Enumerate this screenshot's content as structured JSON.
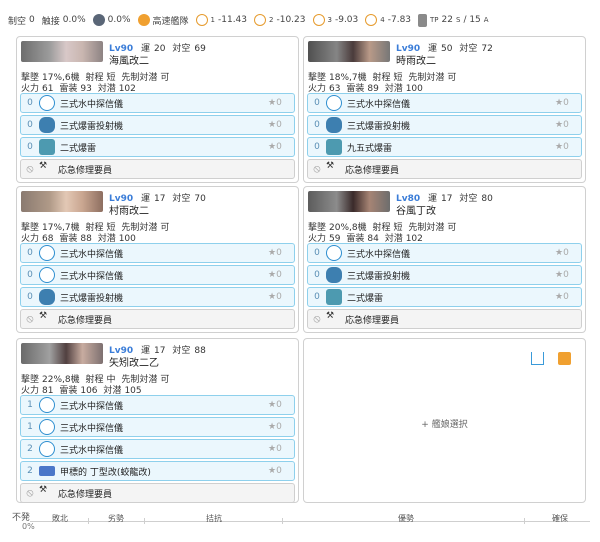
{
  "topbar": {
    "aa_label": "制空",
    "aa_value": "0",
    "touch_label": "触接",
    "touch_value": "0.0%",
    "shield_value": "0.0%",
    "speed_label": "高速艦隊",
    "los": [
      {
        "label": "1",
        "value": "-11.43"
      },
      {
        "label": "2",
        "value": "-10.23"
      },
      {
        "label": "3",
        "value": "-9.03"
      },
      {
        "label": "4",
        "value": "-7.83"
      }
    ],
    "tp_label": "TP",
    "tp_value": "22",
    "tp_s": "S",
    "tp_slash": "/ 15",
    "tp_a": "A",
    "icons": [
      "aircraft-icon",
      "shield-icon",
      "speed-icon",
      "los-icon",
      "transport-icon"
    ],
    "colors": {
      "gold": "#f0a030",
      "dark": "#5a6677"
    }
  },
  "ships": [
    {
      "level": "Lv90",
      "luck_label": "運",
      "luck": "20",
      "aa_label": "対空",
      "aa": "69",
      "name": "海風改二",
      "evasion_label": "撃墜",
      "evasion": "17%,6機",
      "range_label": "射程",
      "range": "短",
      "asw_first_label": "先制対潜",
      "asw_first": "可",
      "fire_label": "火力",
      "fire": "61",
      "torp_label": "雷装",
      "torp": "93",
      "asw_label": "対潜",
      "asw": "102",
      "slots": [
        {
          "count": "0",
          "icon": "sonar-icon",
          "name": "三式水中探信儀",
          "star": "★0"
        },
        {
          "count": "0",
          "icon": "projector-icon",
          "name": "三式爆雷投射機",
          "star": "★0"
        },
        {
          "count": "0",
          "icon": "depth-charge-icon",
          "name": "二式爆雷",
          "star": "★0"
        }
      ],
      "special": {
        "name": "応急修理要員"
      }
    },
    {
      "level": "Lv90",
      "luck_label": "運",
      "luck": "50",
      "aa_label": "対空",
      "aa": "72",
      "name": "時雨改二",
      "evasion_label": "撃墜",
      "evasion": "18%,7機",
      "range_label": "射程",
      "range": "短",
      "asw_first_label": "先制対潜",
      "asw_first": "可",
      "fire_label": "火力",
      "fire": "63",
      "torp_label": "雷装",
      "torp": "89",
      "asw_label": "対潜",
      "asw": "100",
      "slots": [
        {
          "count": "0",
          "icon": "sonar-icon",
          "name": "三式水中探信儀",
          "star": "★0"
        },
        {
          "count": "0",
          "icon": "projector-icon",
          "name": "三式爆雷投射機",
          "star": "★0"
        },
        {
          "count": "0",
          "icon": "depth-charge-icon",
          "name": "九五式爆雷",
          "star": "★0"
        }
      ],
      "special": {
        "name": "応急修理要員"
      }
    },
    {
      "level": "Lv90",
      "luck_label": "運",
      "luck": "17",
      "aa_label": "対空",
      "aa": "70",
      "name": "村雨改二",
      "evasion_label": "撃墜",
      "evasion": "17%,7機",
      "range_label": "射程",
      "range": "短",
      "asw_first_label": "先制対潜",
      "asw_first": "可",
      "fire_label": "火力",
      "fire": "68",
      "torp_label": "雷装",
      "torp": "88",
      "asw_label": "対潜",
      "asw": "100",
      "slots": [
        {
          "count": "0",
          "icon": "sonar-icon",
          "name": "三式水中探信儀",
          "star": "★0"
        },
        {
          "count": "0",
          "icon": "sonar-icon",
          "name": "三式水中探信儀",
          "star": "★0"
        },
        {
          "count": "0",
          "icon": "projector-icon",
          "name": "三式爆雷投射機",
          "star": "★0"
        }
      ],
      "special": {
        "name": "応急修理要員"
      }
    },
    {
      "level": "Lv80",
      "luck_label": "運",
      "luck": "17",
      "aa_label": "対空",
      "aa": "80",
      "name": "谷風丁改",
      "evasion_label": "撃墜",
      "evasion": "20%,8機",
      "range_label": "射程",
      "range": "短",
      "asw_first_label": "先制対潜",
      "asw_first": "可",
      "fire_label": "火力",
      "fire": "59",
      "torp_label": "雷装",
      "torp": "84",
      "asw_label": "対潜",
      "asw": "102",
      "slots": [
        {
          "count": "0",
          "icon": "sonar-icon",
          "name": "三式水中探信儀",
          "star": "★0"
        },
        {
          "count": "0",
          "icon": "projector-icon",
          "name": "三式爆雷投射機",
          "star": "★0"
        },
        {
          "count": "0",
          "icon": "depth-charge-icon",
          "name": "二式爆雷",
          "star": "★0"
        }
      ],
      "special": {
        "name": "応急修理要員"
      }
    },
    {
      "level": "Lv90",
      "luck_label": "運",
      "luck": "17",
      "aa_label": "対空",
      "aa": "88",
      "name": "矢矧改二乙",
      "evasion_label": "撃墜",
      "evasion": "22%,8機",
      "range_label": "射程",
      "range": "中",
      "asw_first_label": "先制対潜",
      "asw_first": "可",
      "fire_label": "火力",
      "fire": "81",
      "torp_label": "雷装",
      "torp": "106",
      "asw_label": "対潜",
      "asw": "105",
      "slots": [
        {
          "count": "1",
          "icon": "sonar-icon",
          "name": "三式水中探信儀",
          "star": "★0"
        },
        {
          "count": "1",
          "icon": "sonar-icon",
          "name": "三式水中探信儀",
          "star": "★0"
        },
        {
          "count": "2",
          "icon": "sonar-icon",
          "name": "三式水中探信儀",
          "star": "★0"
        },
        {
          "count": "2",
          "icon": "radar-icon",
          "name": "甲標的 丁型改(蛟龍改)",
          "star": "★0"
        }
      ],
      "special": {
        "name": "応急修理要員"
      }
    }
  ],
  "empty_slot": {
    "label": "艦娘選択",
    "plus": "+"
  },
  "range": {
    "left_label": "不発",
    "zero": "0%",
    "segments": [
      "敗北",
      "劣勢",
      "拮抗",
      "優勢",
      "確保"
    ]
  }
}
